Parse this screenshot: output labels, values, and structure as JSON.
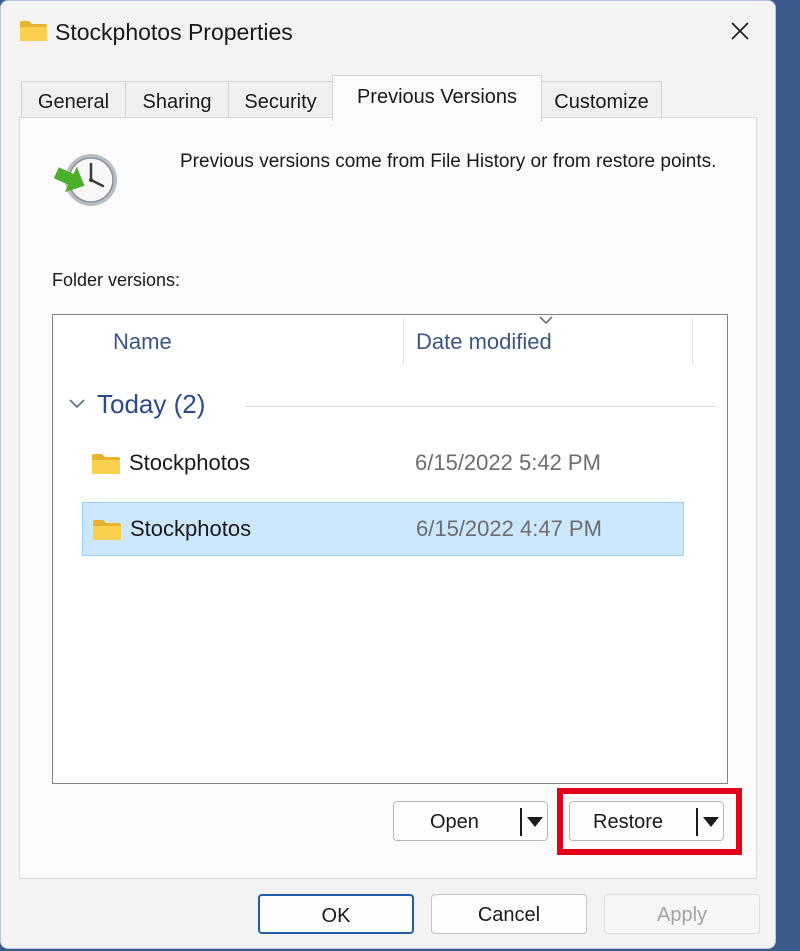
{
  "window": {
    "title": "Stockphotos Properties",
    "title_icon": "folder-icon",
    "close_icon": "close-icon"
  },
  "tabs": [
    {
      "label": "General",
      "active": false
    },
    {
      "label": "Sharing",
      "active": false
    },
    {
      "label": "Security",
      "active": false
    },
    {
      "label": "Previous Versions",
      "active": true
    },
    {
      "label": "Customize",
      "active": false
    }
  ],
  "panel": {
    "icon": "restore-clock-icon",
    "intro": "Previous versions come from File History or from restore points.",
    "versions_label": "Folder versions:",
    "columns": [
      "Name",
      "Date modified"
    ],
    "sorted_column": "Date modified",
    "group": {
      "title": "Today (2)",
      "expanded": true
    },
    "rows": [
      {
        "name": "Stockphotos",
        "date": "6/15/2022 5:42 PM",
        "selected": false,
        "icon": "folder-icon"
      },
      {
        "name": "Stockphotos",
        "date": "6/15/2022 4:47 PM",
        "selected": true,
        "icon": "folder-icon"
      }
    ],
    "open_label": "Open",
    "restore_label": "Restore",
    "restore_highlighted": true
  },
  "footer": {
    "ok_label": "OK",
    "cancel_label": "Cancel",
    "apply_label": "Apply",
    "apply_enabled": false
  },
  "colors": {
    "accent_selection": "#cce8ff",
    "group_title": "#2a4a8e",
    "highlight": "#e5001a",
    "default_button_border": "#1f5faa"
  }
}
